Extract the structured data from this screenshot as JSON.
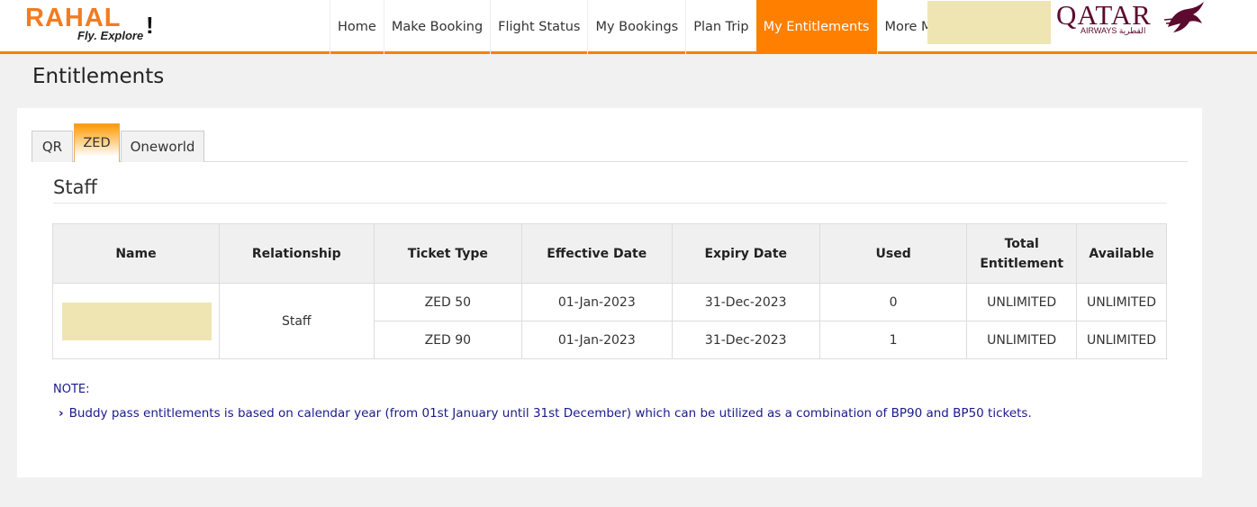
{
  "header": {
    "logo": {
      "main": "RAHAL",
      "tagline": "Fly. Explore",
      "accent": "!"
    },
    "nav": [
      {
        "label": "Home"
      },
      {
        "label": "Make Booking"
      },
      {
        "label": "Flight Status"
      },
      {
        "label": "My Bookings"
      },
      {
        "label": "Plan Trip"
      },
      {
        "label": "My Entitlements",
        "active": true
      },
      {
        "label": "More Menu"
      }
    ],
    "airline_logo": {
      "name": "QATAR",
      "sub": "AIRWAYS القطرية"
    }
  },
  "page": {
    "title": "Entitlements"
  },
  "tabs": [
    {
      "label": "QR"
    },
    {
      "label": "ZED",
      "active": true
    },
    {
      "label": "Oneworld"
    }
  ],
  "section": {
    "title": "Staff"
  },
  "table": {
    "headers": [
      "Name",
      "Relationship",
      "Ticket Type",
      "Effective Date",
      "Expiry Date",
      "Used",
      "Total Entitlement",
      "Available"
    ],
    "relationship": "Staff",
    "rows": [
      {
        "ticket_type": "ZED 50",
        "effective": "01-Jan-2023",
        "expiry": "31-Dec-2023",
        "used": "0",
        "total": "UNLIMITED",
        "available": "UNLIMITED"
      },
      {
        "ticket_type": "ZED 90",
        "effective": "01-Jan-2023",
        "expiry": "31-Dec-2023",
        "used": "1",
        "total": "UNLIMITED",
        "available": "UNLIMITED"
      }
    ]
  },
  "note": {
    "title": "NOTE:",
    "text": "Buddy pass entitlements is based on calendar year (from 01st January until 31st December) which can be utilized as a combination of BP90 and BP50 tickets."
  },
  "colors": {
    "accent": "#ff7f00",
    "brand": "#5c0a2e",
    "note": "#1a1a8c",
    "redaction": "#efe5b3"
  }
}
